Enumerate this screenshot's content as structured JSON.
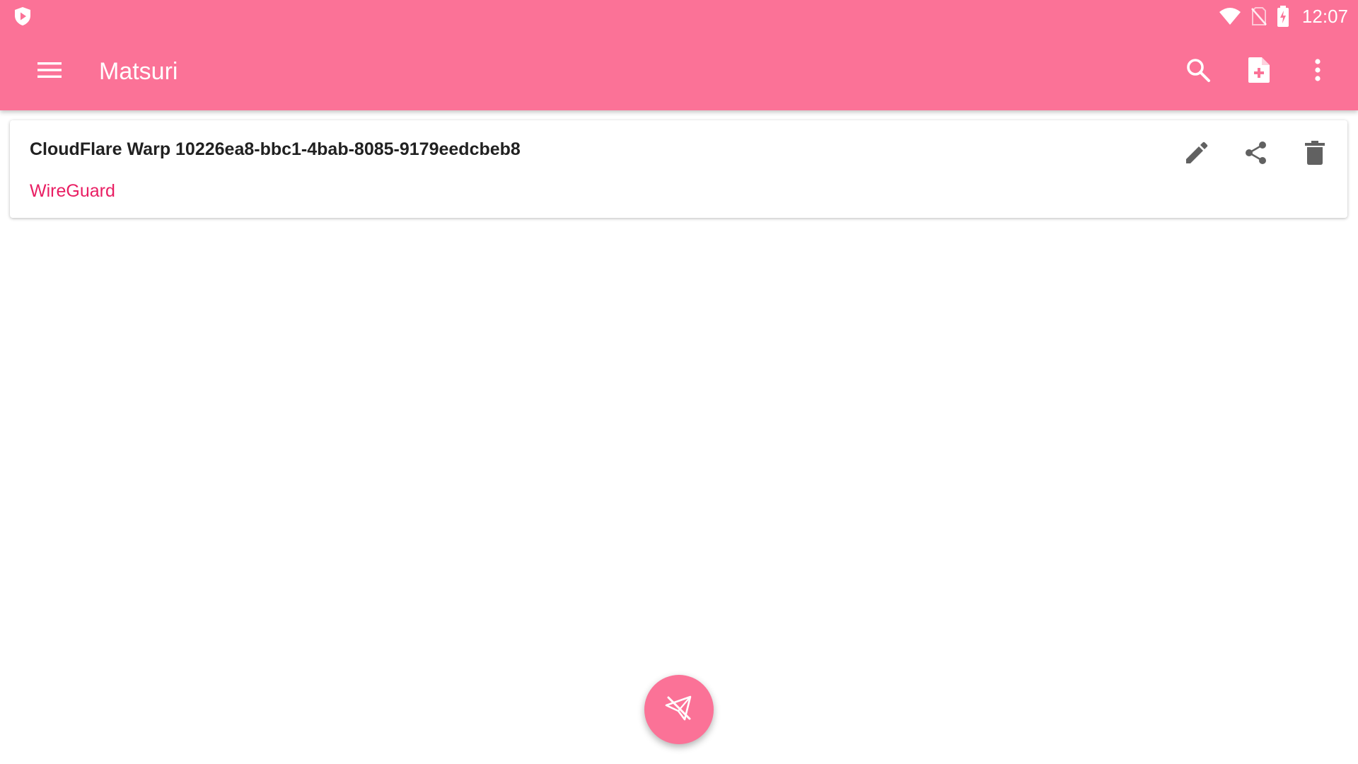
{
  "status_bar": {
    "time": "12:07",
    "icons": [
      "app-shield-icon",
      "wifi-icon",
      "no-sim-icon",
      "battery-charging-icon"
    ]
  },
  "toolbar": {
    "title": "Matsuri",
    "actions": [
      "menu-icon",
      "search-icon",
      "add-file-icon",
      "more-vert-icon"
    ]
  },
  "profiles": [
    {
      "name": "CloudFlare Warp 10226ea8-bbc1-4bab-8085-9179eedcbeb8",
      "type": "WireGuard",
      "actions": [
        "edit-icon",
        "share-icon",
        "delete-icon"
      ]
    }
  ],
  "fab": {
    "icon": "paper-plane-off-icon"
  },
  "colors": {
    "primary": "#fb7297",
    "accent_text": "#e91e63",
    "on_primary": "#ffffff",
    "icon_grey": "#616161",
    "title_text": "#212121"
  }
}
